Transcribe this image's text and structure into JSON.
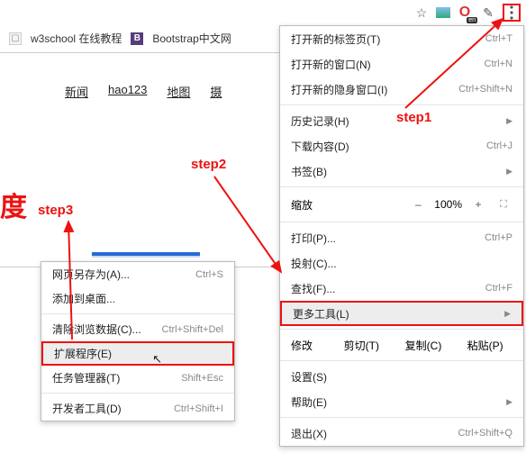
{
  "toolbar": {
    "star": "☆",
    "opera_badge": "en",
    "edit_icon": "✎"
  },
  "bookmarks": {
    "w3_label": "w3school 在线教程",
    "bs_label": "Bootstrap中文网",
    "bs_icon": "B"
  },
  "nav": {
    "news": "新闻",
    "hao123": "hao123",
    "map": "地图",
    "more": "摄"
  },
  "content_char": "度",
  "main_menu": {
    "new_tab": {
      "label": "打开新的标签页(T)",
      "shortcut": "Ctrl+T"
    },
    "new_window": {
      "label": "打开新的窗口(N)",
      "shortcut": "Ctrl+N"
    },
    "incognito": {
      "label": "打开新的隐身窗口(I)",
      "shortcut": "Ctrl+Shift+N"
    },
    "history": {
      "label": "历史记录(H)"
    },
    "downloads": {
      "label": "下载内容(D)",
      "shortcut": "Ctrl+J"
    },
    "bookmarks": {
      "label": "书签(B)"
    },
    "zoom": {
      "label": "缩放",
      "minus": "–",
      "value": "100%",
      "plus": "+",
      "full": "⛶"
    },
    "print": {
      "label": "打印(P)...",
      "shortcut": "Ctrl+P"
    },
    "cast": {
      "label": "投射(C)..."
    },
    "find": {
      "label": "查找(F)...",
      "shortcut": "Ctrl+F"
    },
    "more_tools": {
      "label": "更多工具(L)"
    },
    "edit": {
      "label": "修改",
      "cut": "剪切(T)",
      "copy": "复制(C)",
      "paste": "粘贴(P)"
    },
    "settings": {
      "label": "设置(S)"
    },
    "help": {
      "label": "帮助(E)"
    },
    "exit": {
      "label": "退出(X)",
      "shortcut": "Ctrl+Shift+Q"
    }
  },
  "sub_menu": {
    "save_as": {
      "label": "网页另存为(A)...",
      "shortcut": "Ctrl+S"
    },
    "add_desktop": {
      "label": "添加到桌面..."
    },
    "clear_data": {
      "label": "清除浏览数据(C)...",
      "shortcut": "Ctrl+Shift+Del"
    },
    "extensions": {
      "label": "扩展程序(E)"
    },
    "taskmgr": {
      "label": "任务管理器(T)",
      "shortcut": "Shift+Esc"
    },
    "devtools": {
      "label": "开发者工具(D)",
      "shortcut": "Ctrl+Shift+I"
    }
  },
  "annotations": {
    "step1": "step1",
    "step2": "step2",
    "step3": "step3"
  }
}
